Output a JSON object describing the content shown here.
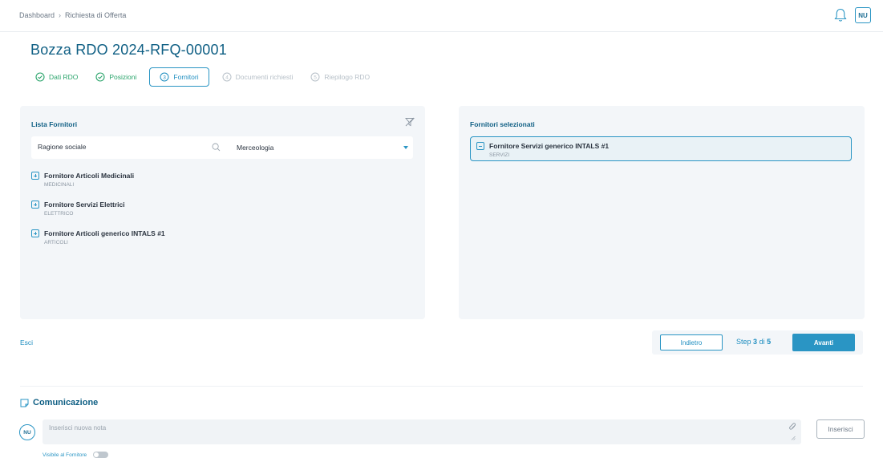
{
  "breadcrumb": {
    "items": [
      "Dashboard",
      "Richiesta di Offerta"
    ],
    "separator": "›"
  },
  "header": {
    "avatar_initials": "NU"
  },
  "page": {
    "title": "Bozza RDO 2024-RFQ-00001"
  },
  "steps": [
    {
      "label": "Dati RDO",
      "status": "done"
    },
    {
      "label": "Posizioni",
      "status": "done"
    },
    {
      "label": "Fornitori",
      "number": "3",
      "status": "active"
    },
    {
      "label": "Documenti richiesti",
      "number": "4",
      "status": "todo"
    },
    {
      "label": "Riepilogo RDO",
      "number": "5",
      "status": "todo"
    }
  ],
  "left_panel": {
    "title": "Lista Fornitori",
    "search_placeholder": "Ragione sociale",
    "category_select": "Merceologia",
    "suppliers": [
      {
        "name": "Fornitore Articoli Medicinali",
        "category": "MEDICINALI"
      },
      {
        "name": "Fornitore Servizi Elettrici",
        "category": "ELETTRICO"
      },
      {
        "name": "Fornitore Articoli generico INTALS #1",
        "category": "ARTICOLI"
      }
    ]
  },
  "right_panel": {
    "title": "Fornitori selezionati",
    "selected": [
      {
        "name": "Fornitore Servizi generico INTALS #1",
        "category": "SERVIZI"
      }
    ]
  },
  "footer": {
    "exit_label": "Esci",
    "back_label": "Indietro",
    "step_prefix": "Step",
    "step_current": "3",
    "step_of": "di",
    "step_total": "5",
    "next_label": "Avanti"
  },
  "communication": {
    "title": "Comunicazione",
    "avatar_initials": "NU",
    "note_placeholder": "Inserisci nuova nota",
    "insert_label": "Inserisci",
    "visible_label": "Visibile al Fornitore",
    "visible_enabled": false
  },
  "colors": {
    "primary": "#2a95c4",
    "title": "#0f5f84",
    "success": "#2aa46b",
    "panel_bg": "#f3f6f9"
  }
}
